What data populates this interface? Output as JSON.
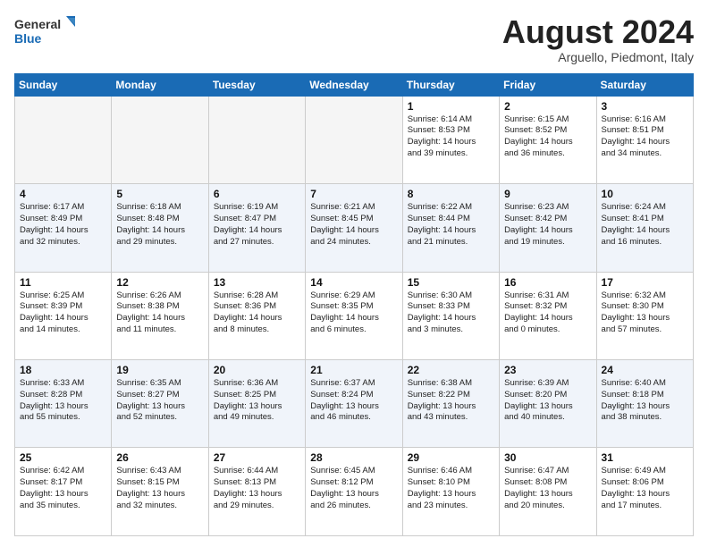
{
  "header": {
    "logo_line1": "General",
    "logo_line2": "Blue",
    "month_title": "August 2024",
    "location": "Arguello, Piedmont, Italy"
  },
  "days_of_week": [
    "Sunday",
    "Monday",
    "Tuesday",
    "Wednesday",
    "Thursday",
    "Friday",
    "Saturday"
  ],
  "weeks": [
    [
      {
        "num": "",
        "info": "",
        "empty": true
      },
      {
        "num": "",
        "info": "",
        "empty": true
      },
      {
        "num": "",
        "info": "",
        "empty": true
      },
      {
        "num": "",
        "info": "",
        "empty": true
      },
      {
        "num": "1",
        "info": "Sunrise: 6:14 AM\nSunset: 8:53 PM\nDaylight: 14 hours\nand 39 minutes."
      },
      {
        "num": "2",
        "info": "Sunrise: 6:15 AM\nSunset: 8:52 PM\nDaylight: 14 hours\nand 36 minutes."
      },
      {
        "num": "3",
        "info": "Sunrise: 6:16 AM\nSunset: 8:51 PM\nDaylight: 14 hours\nand 34 minutes."
      }
    ],
    [
      {
        "num": "4",
        "info": "Sunrise: 6:17 AM\nSunset: 8:49 PM\nDaylight: 14 hours\nand 32 minutes."
      },
      {
        "num": "5",
        "info": "Sunrise: 6:18 AM\nSunset: 8:48 PM\nDaylight: 14 hours\nand 29 minutes."
      },
      {
        "num": "6",
        "info": "Sunrise: 6:19 AM\nSunset: 8:47 PM\nDaylight: 14 hours\nand 27 minutes."
      },
      {
        "num": "7",
        "info": "Sunrise: 6:21 AM\nSunset: 8:45 PM\nDaylight: 14 hours\nand 24 minutes."
      },
      {
        "num": "8",
        "info": "Sunrise: 6:22 AM\nSunset: 8:44 PM\nDaylight: 14 hours\nand 21 minutes."
      },
      {
        "num": "9",
        "info": "Sunrise: 6:23 AM\nSunset: 8:42 PM\nDaylight: 14 hours\nand 19 minutes."
      },
      {
        "num": "10",
        "info": "Sunrise: 6:24 AM\nSunset: 8:41 PM\nDaylight: 14 hours\nand 16 minutes."
      }
    ],
    [
      {
        "num": "11",
        "info": "Sunrise: 6:25 AM\nSunset: 8:39 PM\nDaylight: 14 hours\nand 14 minutes."
      },
      {
        "num": "12",
        "info": "Sunrise: 6:26 AM\nSunset: 8:38 PM\nDaylight: 14 hours\nand 11 minutes."
      },
      {
        "num": "13",
        "info": "Sunrise: 6:28 AM\nSunset: 8:36 PM\nDaylight: 14 hours\nand 8 minutes."
      },
      {
        "num": "14",
        "info": "Sunrise: 6:29 AM\nSunset: 8:35 PM\nDaylight: 14 hours\nand 6 minutes."
      },
      {
        "num": "15",
        "info": "Sunrise: 6:30 AM\nSunset: 8:33 PM\nDaylight: 14 hours\nand 3 minutes."
      },
      {
        "num": "16",
        "info": "Sunrise: 6:31 AM\nSunset: 8:32 PM\nDaylight: 14 hours\nand 0 minutes."
      },
      {
        "num": "17",
        "info": "Sunrise: 6:32 AM\nSunset: 8:30 PM\nDaylight: 13 hours\nand 57 minutes."
      }
    ],
    [
      {
        "num": "18",
        "info": "Sunrise: 6:33 AM\nSunset: 8:28 PM\nDaylight: 13 hours\nand 55 minutes."
      },
      {
        "num": "19",
        "info": "Sunrise: 6:35 AM\nSunset: 8:27 PM\nDaylight: 13 hours\nand 52 minutes."
      },
      {
        "num": "20",
        "info": "Sunrise: 6:36 AM\nSunset: 8:25 PM\nDaylight: 13 hours\nand 49 minutes."
      },
      {
        "num": "21",
        "info": "Sunrise: 6:37 AM\nSunset: 8:24 PM\nDaylight: 13 hours\nand 46 minutes."
      },
      {
        "num": "22",
        "info": "Sunrise: 6:38 AM\nSunset: 8:22 PM\nDaylight: 13 hours\nand 43 minutes."
      },
      {
        "num": "23",
        "info": "Sunrise: 6:39 AM\nSunset: 8:20 PM\nDaylight: 13 hours\nand 40 minutes."
      },
      {
        "num": "24",
        "info": "Sunrise: 6:40 AM\nSunset: 8:18 PM\nDaylight: 13 hours\nand 38 minutes."
      }
    ],
    [
      {
        "num": "25",
        "info": "Sunrise: 6:42 AM\nSunset: 8:17 PM\nDaylight: 13 hours\nand 35 minutes."
      },
      {
        "num": "26",
        "info": "Sunrise: 6:43 AM\nSunset: 8:15 PM\nDaylight: 13 hours\nand 32 minutes."
      },
      {
        "num": "27",
        "info": "Sunrise: 6:44 AM\nSunset: 8:13 PM\nDaylight: 13 hours\nand 29 minutes."
      },
      {
        "num": "28",
        "info": "Sunrise: 6:45 AM\nSunset: 8:12 PM\nDaylight: 13 hours\nand 26 minutes."
      },
      {
        "num": "29",
        "info": "Sunrise: 6:46 AM\nSunset: 8:10 PM\nDaylight: 13 hours\nand 23 minutes."
      },
      {
        "num": "30",
        "info": "Sunrise: 6:47 AM\nSunset: 8:08 PM\nDaylight: 13 hours\nand 20 minutes."
      },
      {
        "num": "31",
        "info": "Sunrise: 6:49 AM\nSunset: 8:06 PM\nDaylight: 13 hours\nand 17 minutes."
      }
    ]
  ]
}
